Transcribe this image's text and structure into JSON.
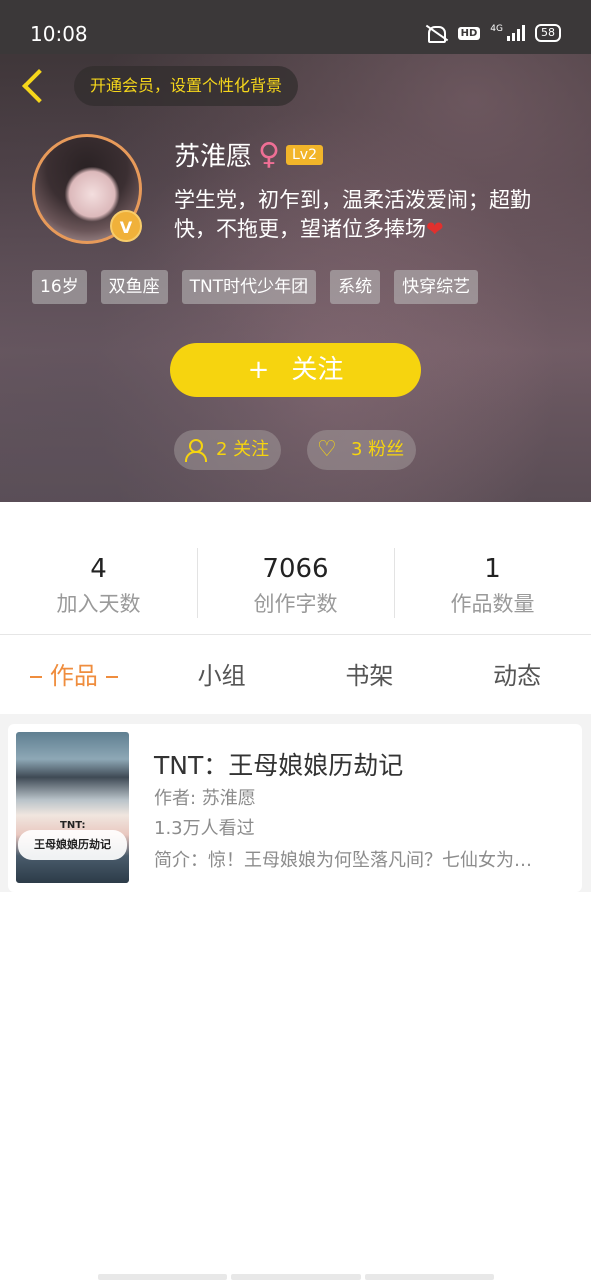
{
  "status_bar": {
    "time": "10:08",
    "network_badge": "HD",
    "network_type": "4G",
    "battery": "58"
  },
  "header": {
    "vip_banner": "开通会员，设置个性化背景"
  },
  "profile": {
    "name": "苏淮愿",
    "gender_symbol": "♀",
    "level": "Lv2",
    "verified_badge": "V",
    "bio": "学生党，初乍到，温柔活泼爱闹；超勤快，不拖更，望诸位多捧场",
    "bio_heart": "❤",
    "tags": [
      "16岁",
      "双鱼座",
      "TNT时代少年团",
      "系统",
      "快穿综艺"
    ],
    "follow_button": "关注",
    "follow_plus": "+",
    "following_label": "2 关注",
    "fans_label": "3 粉丝"
  },
  "stats": [
    {
      "value": "4",
      "label": "加入天数"
    },
    {
      "value": "7066",
      "label": "创作字数"
    },
    {
      "value": "1",
      "label": "作品数量"
    }
  ],
  "tabs": [
    {
      "label": "作品",
      "active": true
    },
    {
      "label": "小组",
      "active": false
    },
    {
      "label": "书架",
      "active": false
    },
    {
      "label": "动态",
      "active": false
    }
  ],
  "works": [
    {
      "title": "TNT：王母娘娘历劫记",
      "author": "作者: 苏淮愿",
      "views": "1.3万人看过",
      "intro": "简介：惊！王母娘娘为何坠落凡间？七仙女为…",
      "cover_caption": "王母娘娘历劫记",
      "cover_tag": "TNT:"
    }
  ],
  "colors": {
    "accent_yellow": "#f6d40f",
    "tab_active": "#ef8d3e",
    "level_badge": "#f2b52a"
  }
}
